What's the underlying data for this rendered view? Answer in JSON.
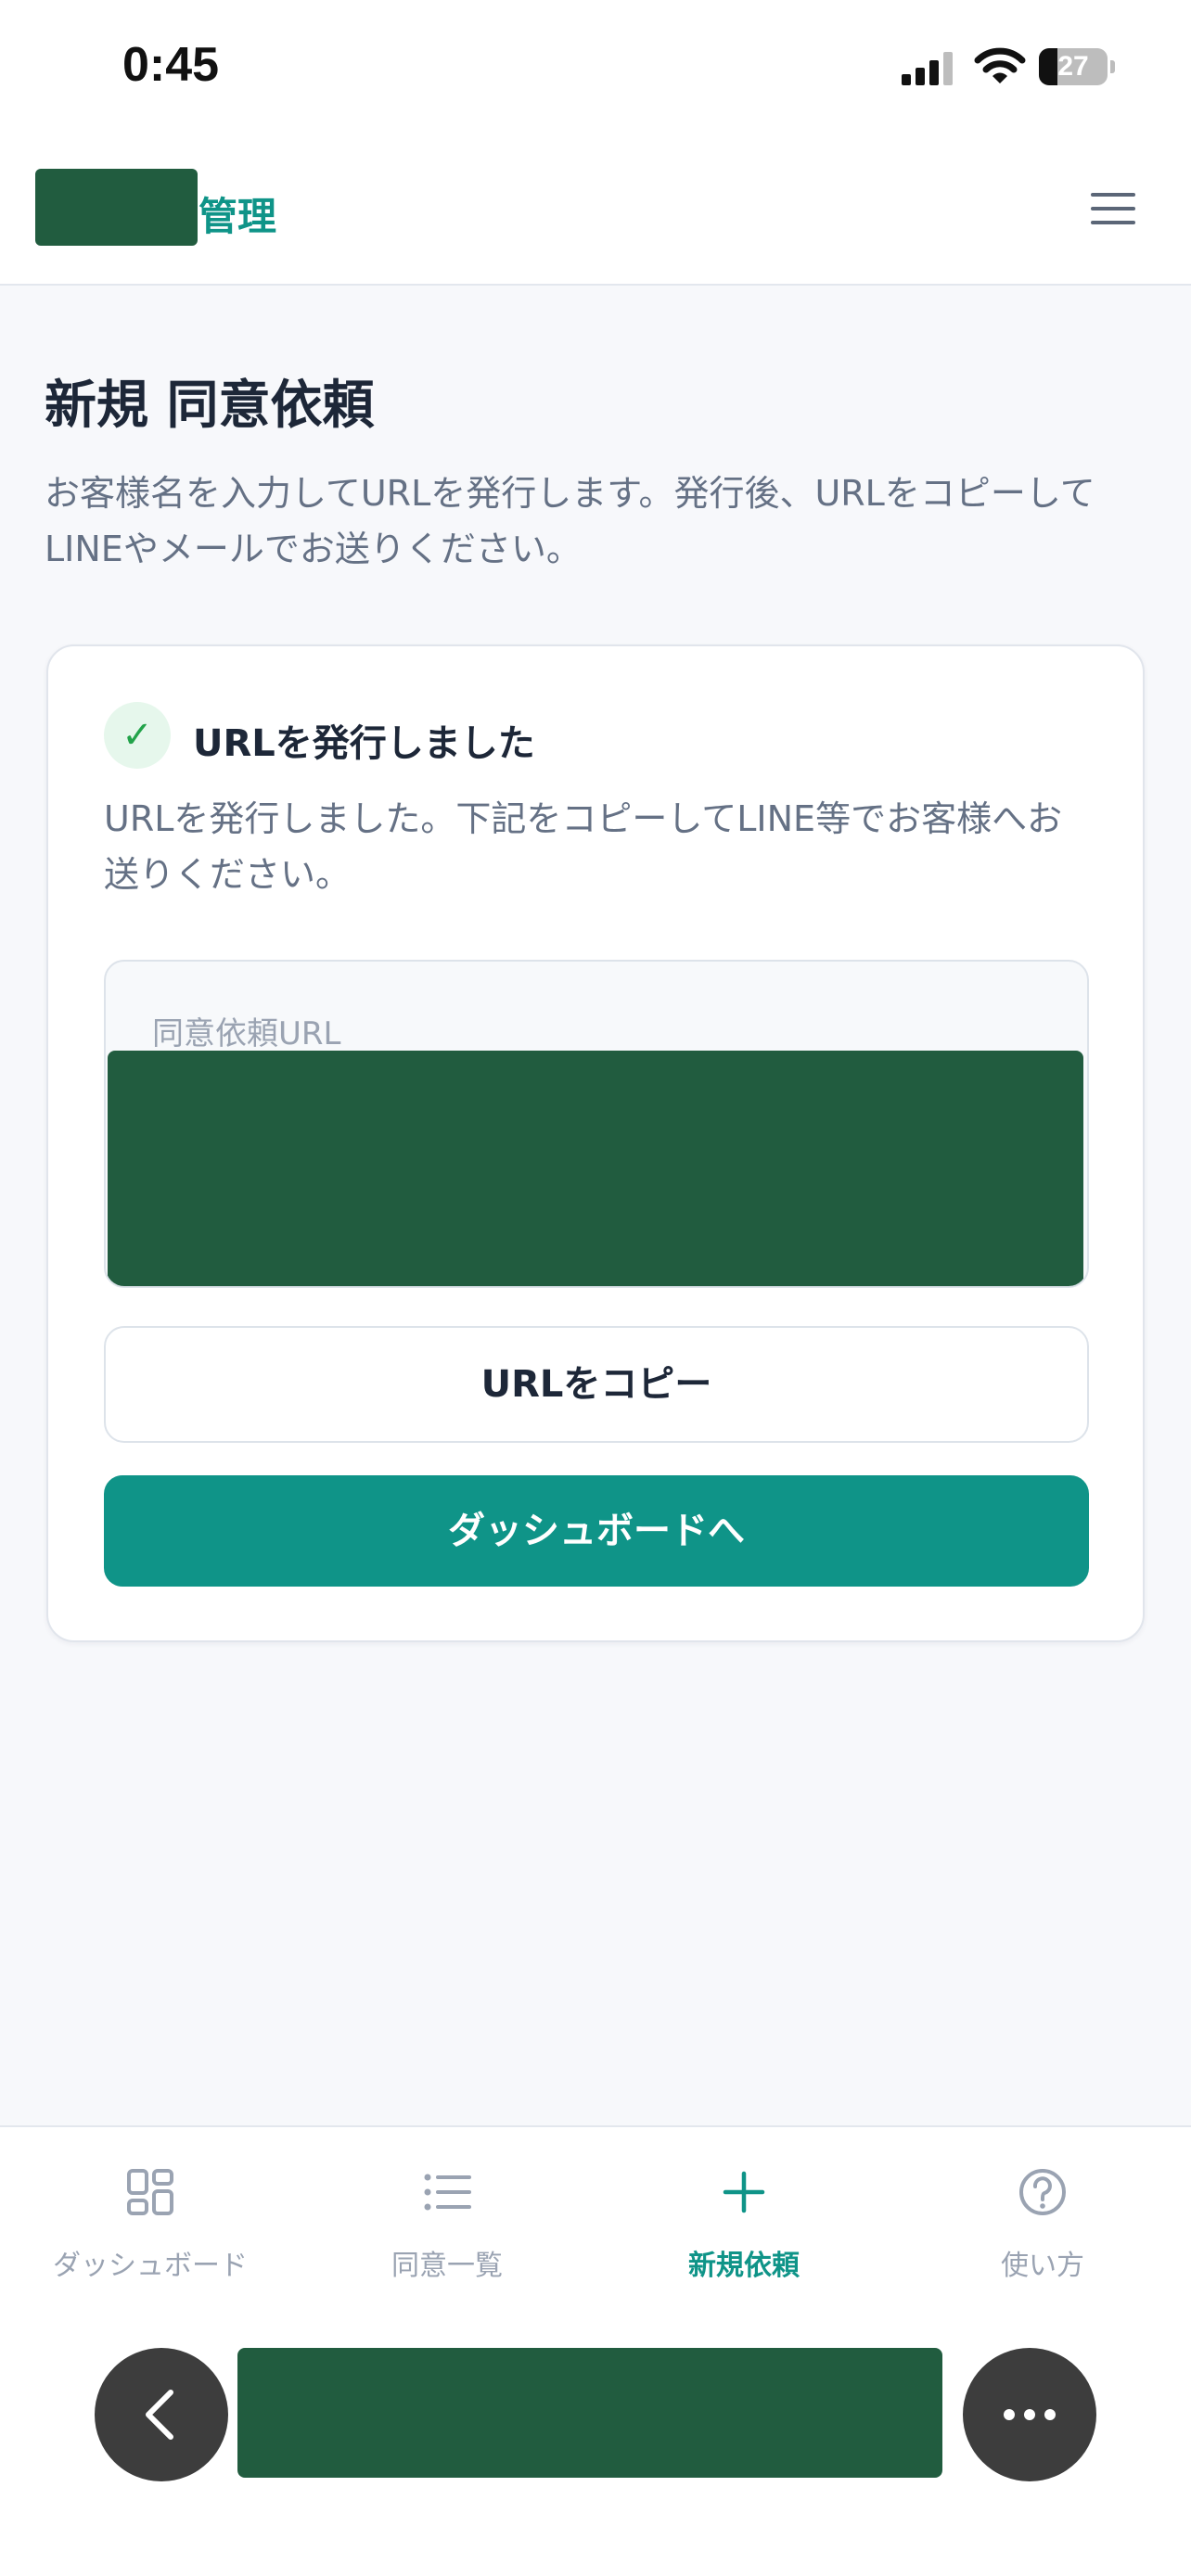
{
  "status_bar": {
    "time": "0:45",
    "battery_level": "27",
    "icons": [
      "cellular-signal-icon",
      "wifi-icon",
      "battery-icon"
    ]
  },
  "header": {
    "app_title_visible": "意管理",
    "menu_icon": "hamburger-menu-icon"
  },
  "page": {
    "title": "新規 同意依頼",
    "description": "お客様名を入力してURLを発行します。発行後、URLをコピーしてLINEやメールでお送りください。"
  },
  "result_card": {
    "icon": "check-icon",
    "check_glyph": "✓",
    "title": "URLを発行しました",
    "description": "URLを発行しました。下記をコピーしてLINE等でお客様へお送りください。",
    "url_field": {
      "label": "同意依頼URL",
      "value": ""
    },
    "copy_button": "URLをコピー",
    "dashboard_button": "ダッシュボードへ"
  },
  "tab_bar": {
    "items": [
      {
        "label": "ダッシュボード",
        "icon": "dashboard-grid-icon",
        "active": false
      },
      {
        "label": "同意一覧",
        "icon": "list-icon",
        "active": false
      },
      {
        "label": "新規依頼",
        "icon": "plus-icon",
        "active": true
      },
      {
        "label": "使い方",
        "icon": "help-circle-icon",
        "active": false
      }
    ]
  },
  "browser_bar": {
    "back_icon": "chevron-left-icon",
    "address": "",
    "more_icon": "more-horizontal-icon"
  },
  "colors": {
    "accent": "#0f9488",
    "success": "#22a34a",
    "redaction": "#215c3f",
    "text_primary": "#1d2738",
    "text_secondary": "#657185",
    "muted": "#9aa3b2",
    "background": "#f7f8fb"
  }
}
